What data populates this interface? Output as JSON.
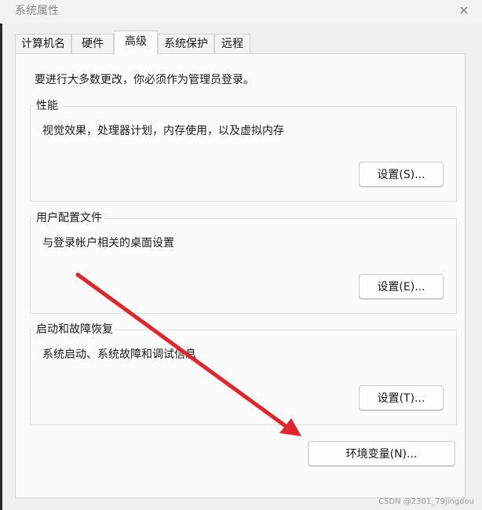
{
  "window": {
    "title": "系统属性",
    "close_glyph": "✕"
  },
  "tabs": [
    {
      "label": "计算机名",
      "active": false
    },
    {
      "label": "硬件",
      "active": false
    },
    {
      "label": "高级",
      "active": true
    },
    {
      "label": "系统保护",
      "active": false
    },
    {
      "label": "远程",
      "active": false
    }
  ],
  "advanced": {
    "intro": "要进行大多数更改，你必须作为管理员登录。",
    "performance": {
      "title": "性能",
      "description": "视觉效果，处理器计划，内存使用，以及虚拟内存",
      "button": "设置(S)..."
    },
    "user_profiles": {
      "title": "用户配置文件",
      "description": "与登录帐户相关的桌面设置",
      "button": "设置(E)..."
    },
    "startup_recovery": {
      "title": "启动和故障恢复",
      "description": "系统启动、系统故障和调试信息",
      "button": "设置(T)..."
    },
    "env_button": "环境变量(N)..."
  },
  "annotation": {
    "arrow_color": "#e0262b"
  },
  "watermark": "CSDN @2301_79jingdou"
}
